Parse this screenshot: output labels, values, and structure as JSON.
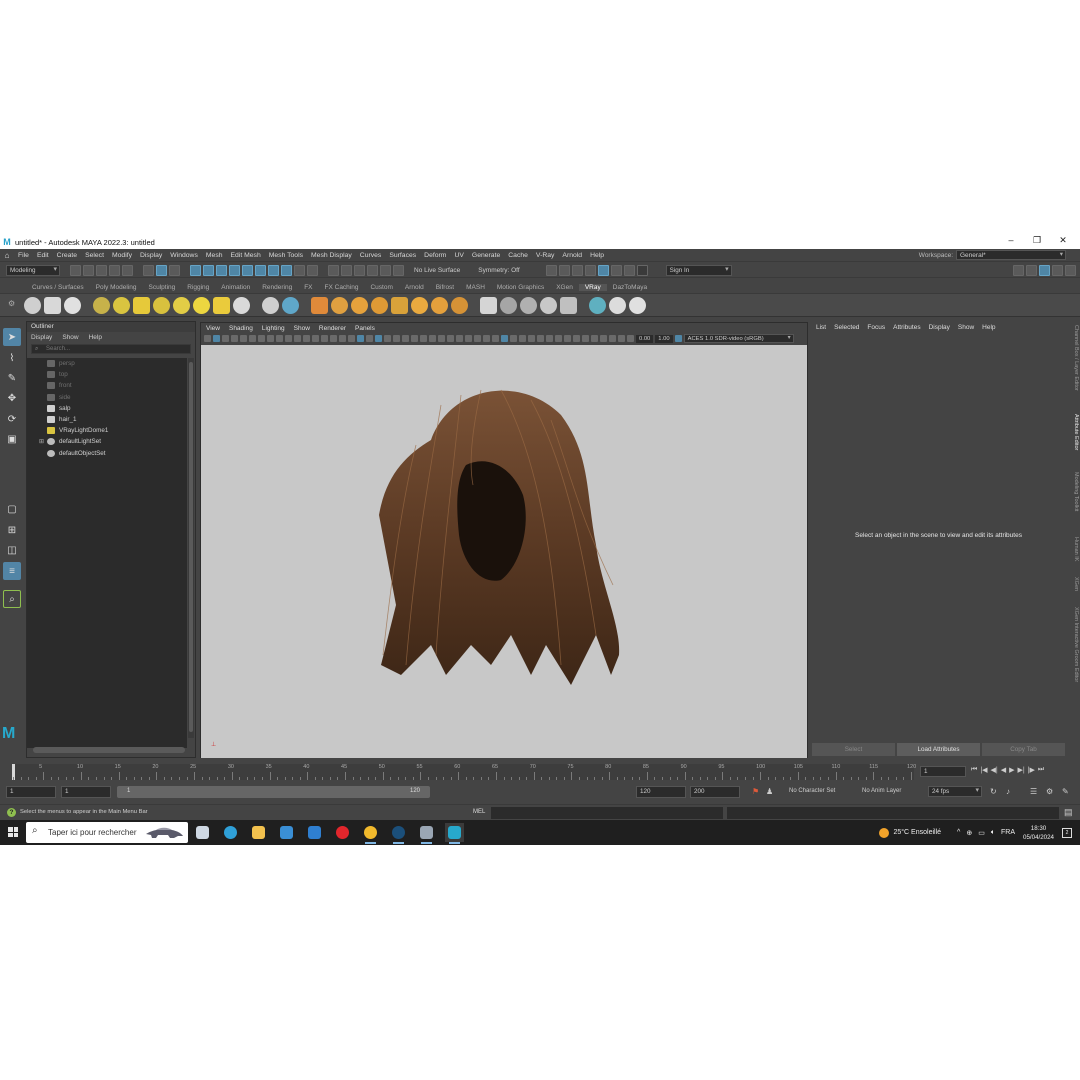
{
  "window": {
    "title": "untitled* - Autodesk MAYA 2022.3: untitled",
    "controls": [
      "–",
      "❐",
      "✕"
    ]
  },
  "menubar": {
    "items": [
      "File",
      "Edit",
      "Create",
      "Select",
      "Modify",
      "Display",
      "Windows",
      "Mesh",
      "Edit Mesh",
      "Mesh Tools",
      "Mesh Display",
      "Curves",
      "Surfaces",
      "Deform",
      "UV",
      "Generate",
      "Cache",
      "V-Ray",
      "Arnold",
      "Help"
    ],
    "workspace_label": "Workspace:",
    "workspace_value": "General*"
  },
  "statusline": {
    "mode": "Modeling",
    "live_surface": "No Live Surface",
    "symmetry": "Symmetry: Off",
    "sign_in": "Sign In"
  },
  "shelf": {
    "tabs": [
      "Curves / Surfaces",
      "Poly Modeling",
      "Sculpting",
      "Rigging",
      "Animation",
      "Rendering",
      "FX",
      "FX Caching",
      "Custom",
      "Arnold",
      "Bifrost",
      "MASH",
      "Motion Graphics",
      "XGen",
      "VRay",
      "DazToMaya"
    ],
    "active_tab": "VRay",
    "icon_colors": [
      "#cfcfcf",
      "#d8d8d8",
      "#e0e0e0",
      "#c7b24a",
      "#d9c440",
      "#e6c93a",
      "#d8c13e",
      "#e2cd46",
      "#ecd640",
      "#eacb3c",
      "#d9d9d9",
      "#cfcfcf",
      "#5fa7c9",
      "#e08a3a",
      "#e0a040",
      "#e6a23c",
      "#df9a35",
      "#d9a23a",
      "#eaaa3f",
      "#e4a03c",
      "#d59236",
      "#d5d5d5",
      "#a6a6a6",
      "#b0b0b0",
      "#c8c8c8",
      "#c0c0c0",
      "#5fb0c0",
      "#dcdcdc",
      "#e0e0e0"
    ]
  },
  "outliner": {
    "title": "Outliner",
    "menu": [
      "Display",
      "Show",
      "Help"
    ],
    "search_placeholder": "Search...",
    "items": [
      {
        "label": "persp",
        "dim": true,
        "icon": "camera-icon"
      },
      {
        "label": "top",
        "dim": true,
        "icon": "camera-icon"
      },
      {
        "label": "front",
        "dim": true,
        "icon": "camera-icon"
      },
      {
        "label": "side",
        "dim": true,
        "icon": "camera-icon"
      },
      {
        "label": "salp",
        "dim": false,
        "icon": "transform-icon"
      },
      {
        "label": "hair_1",
        "dim": false,
        "icon": "transform-icon"
      },
      {
        "label": "VRayLightDome1",
        "dim": false,
        "icon": "dome-light-icon"
      },
      {
        "label": "defaultLightSet",
        "dim": false,
        "icon": "set-icon"
      },
      {
        "label": "defaultObjectSet",
        "dim": false,
        "icon": "set-icon"
      }
    ]
  },
  "viewport": {
    "menu": [
      "View",
      "Shading",
      "Lighting",
      "Show",
      "Renderer",
      "Panels"
    ],
    "exposure": "0.00",
    "gamma": "1.00",
    "color_space": "ACES 1.0 SDR-video (sRGB)",
    "background": "#c8c8c8",
    "hair_color": "#5a3a22"
  },
  "attribute_editor": {
    "menu": [
      "List",
      "Selected",
      "Focus",
      "Attributes",
      "Display",
      "Show",
      "Help"
    ],
    "message": "Select an object in the scene to view and edit its attributes",
    "buttons": [
      "Select",
      "Load Attributes",
      "Copy Tab"
    ]
  },
  "side_tabs": [
    "Channel Box / Layer Editor",
    "Attribute Editor",
    "Modeling Toolkit",
    "Human IK",
    "XGen",
    "XGen Interactive Groom Editor"
  ],
  "timeline": {
    "ticks": [
      "5",
      "10",
      "15",
      "20",
      "25",
      "30",
      "35",
      "40",
      "45",
      "50",
      "55",
      "60",
      "65",
      "70",
      "75",
      "80",
      "85",
      "90",
      "95",
      "100",
      "105",
      "110",
      "115",
      "120"
    ],
    "start": 1,
    "end": 120,
    "current_frame": "1",
    "playback": [
      "⏮",
      "|◀",
      "◀|",
      "◀",
      "▶",
      "▶|",
      "|▶",
      "⏭"
    ]
  },
  "range": {
    "start": "1",
    "playback_start": "1",
    "slider_start": "1",
    "slider_end": "120",
    "playback_end": "120",
    "end": "200",
    "character_set": "No Character Set",
    "anim_layer": "No Anim Layer",
    "fps": "24 fps"
  },
  "commandline": {
    "help": "Select the menus to appear in the Main Menu Bar",
    "lang": "MEL"
  },
  "taskbar": {
    "search": "Taper ici pour rechercher",
    "apps": [
      {
        "name": "task-view",
        "color": "#cfd8e3"
      },
      {
        "name": "edge",
        "color": "#2fa0d8"
      },
      {
        "name": "file-explorer",
        "color": "#f2c14e"
      },
      {
        "name": "store",
        "color": "#3a8fd6"
      },
      {
        "name": "mail",
        "color": "#2f7fd0"
      },
      {
        "name": "opera",
        "color": "#e2262c"
      },
      {
        "name": "chrome",
        "color": "#f1b92c"
      },
      {
        "name": "steam",
        "color": "#1b4f7a"
      },
      {
        "name": "app",
        "color": "#9aa6b4"
      },
      {
        "name": "maya",
        "color": "#27a9cc"
      }
    ],
    "weather": "25°C  Ensoleillé",
    "lang": "FRA",
    "time": "18:30",
    "date": "05/04/2024"
  }
}
